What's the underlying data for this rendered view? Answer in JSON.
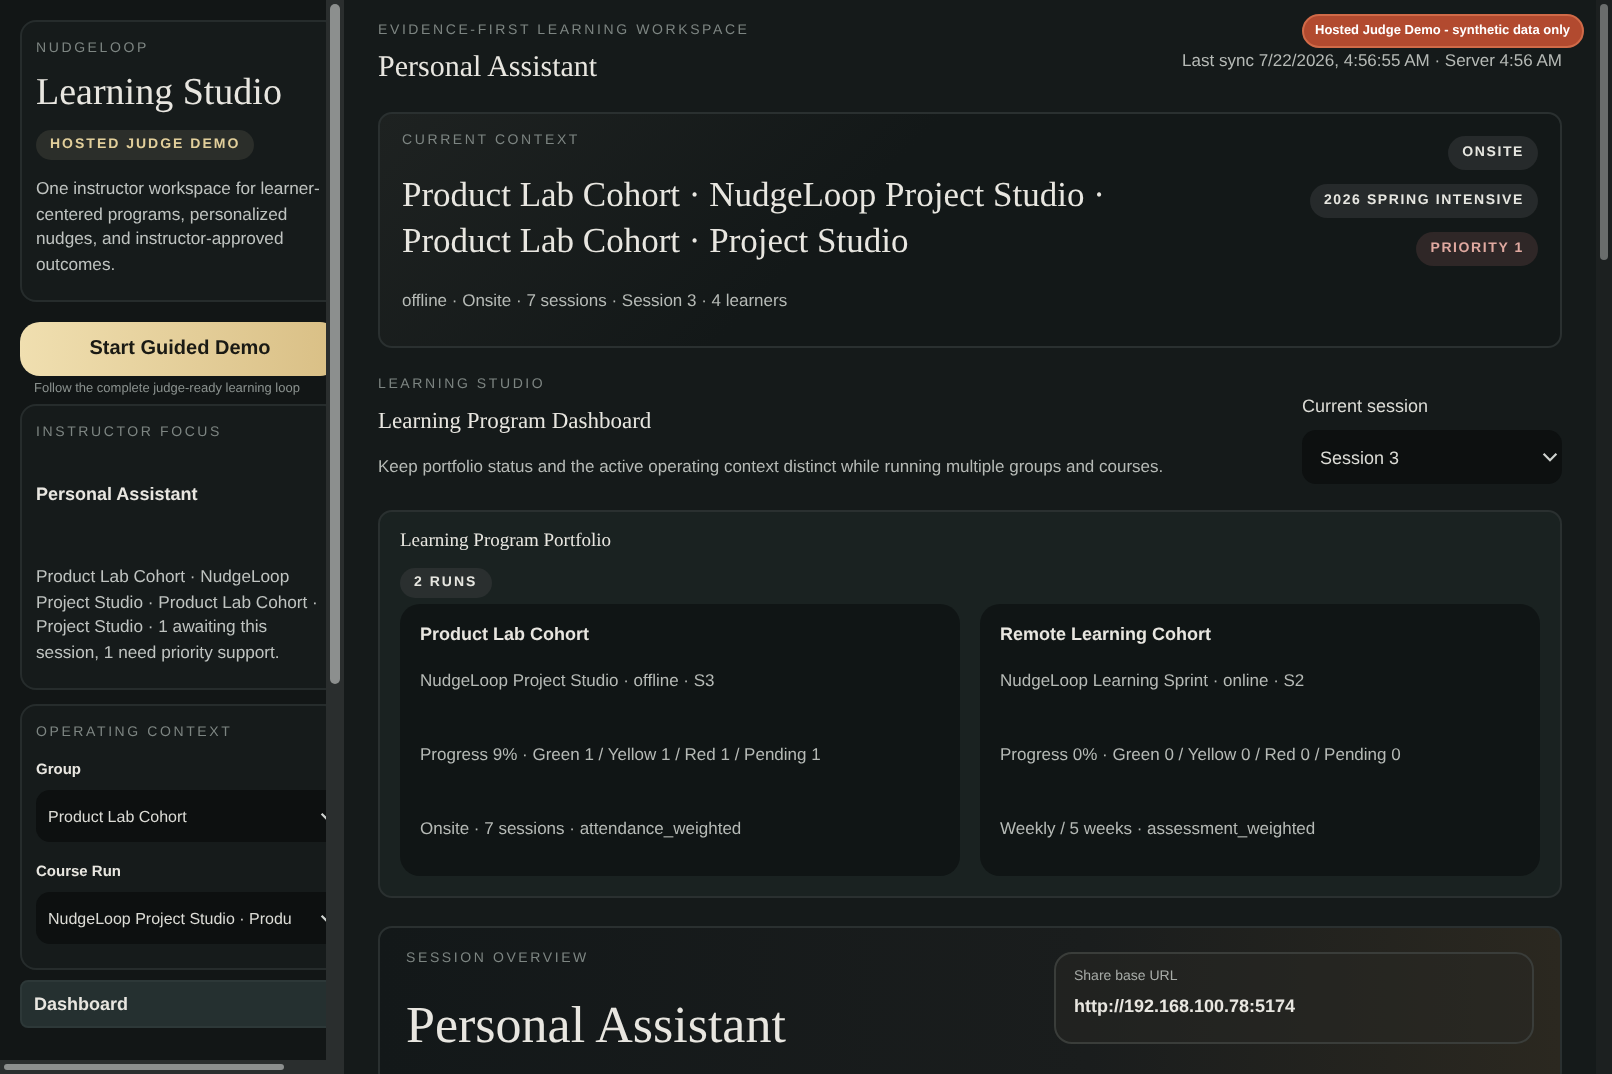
{
  "sidebar": {
    "brand_kicker": "NUDGELOOP",
    "title": "Learning Studio",
    "badge": "HOSTED JUDGE DEMO",
    "description": "One instructor workspace for learner-centered programs, personalized nudges, and instructor-approved outcomes.",
    "start_button": "Start Guided Demo",
    "start_hint": "Follow the complete judge-ready learning loop",
    "focus": {
      "heading": "INSTRUCTOR FOCUS",
      "title": "Personal Assistant",
      "text": "Product Lab Cohort · NudgeLoop Project Studio · Product Lab Cohort · Project Studio · 1 awaiting this session, 1 need priority support."
    },
    "operating": {
      "heading": "OPERATING CONTEXT",
      "fields": [
        {
          "label": "Group",
          "value": "Product Lab Cohort"
        },
        {
          "label": "Course Run",
          "value": "NudgeLoop Project Studio · Produ"
        }
      ]
    },
    "nav": [
      {
        "label": "Dashboard",
        "selected": true
      }
    ]
  },
  "header": {
    "kicker": "EVIDENCE-FIRST LEARNING WORKSPACE",
    "title": "Personal Assistant",
    "demo_badge": "Hosted Judge Demo - synthetic data only",
    "last_sync": "Last sync 7/22/2026, 4:56:55 AM · Server 4:56 AM"
  },
  "context": {
    "kicker": "CURRENT CONTEXT",
    "title": "Product Lab Cohort · NudgeLoop Project Studio · Product Lab Cohort · Project Studio",
    "meta": "offline · Onsite · 7 sessions · Session 3 · 4 learners",
    "tags": [
      {
        "label": "ONSITE",
        "kind": "neutral"
      },
      {
        "label": "2026 SPRING INTENSIVE",
        "kind": "neutral"
      },
      {
        "label": "PRIORITY 1",
        "kind": "priority"
      }
    ]
  },
  "studio": {
    "kicker": "LEARNING STUDIO",
    "title": "Learning Program Dashboard",
    "description": "Keep portfolio status and the active operating context distinct while running multiple groups and courses.",
    "session_label": "Current session",
    "session_value": "Session 3"
  },
  "portfolio": {
    "title": "Learning Program Portfolio",
    "count": "2 RUNS",
    "runs": [
      {
        "name": "Product Lab Cohort",
        "lines": [
          "NudgeLoop Project Studio · offline · S3",
          "Progress 9% · Green 1 / Yellow 1 / Red 1 / Pending 1",
          "Onsite · 7 sessions · attendance_weighted"
        ]
      },
      {
        "name": "Remote Learning Cohort",
        "lines": [
          "NudgeLoop Learning Sprint · online · S2",
          "Progress 0% · Green 0 / Yellow 0 / Red 0 / Pending 0",
          "Weekly / 5 weeks · assessment_weighted"
        ]
      }
    ]
  },
  "overview": {
    "kicker": "SESSION OVERVIEW",
    "title": "Personal Assistant",
    "share_label": "Share base URL",
    "share_url": "http://192.168.100.78:5174"
  }
}
